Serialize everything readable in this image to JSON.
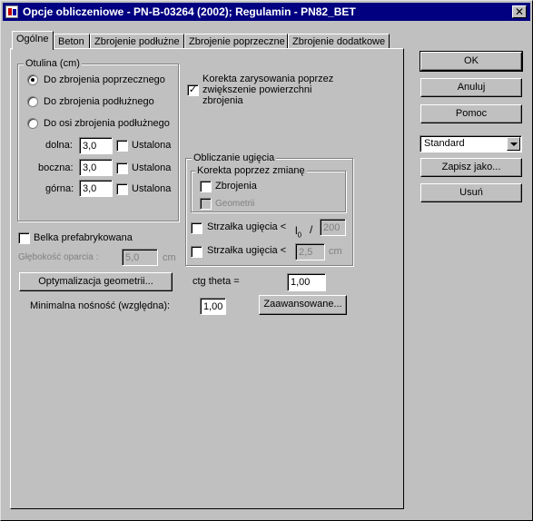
{
  "window": {
    "title": "Opcje obliczeniowe - PN-B-03264 (2002);   Regulamin - PN82_BET",
    "close_glyph": "✕"
  },
  "tabs": [
    {
      "label": "Ogólne"
    },
    {
      "label": "Beton"
    },
    {
      "label": "Zbrojenie podłużne"
    },
    {
      "label": "Zbrojenie poprzeczne"
    },
    {
      "label": "Zbrojenie dodatkowe"
    }
  ],
  "otulina": {
    "title": "Otulina (cm)",
    "radio_poprzeczne": "Do zbrojenia poprzecznego",
    "radio_podluzne": "Do zbrojenia podłużnego",
    "radio_osi": "Do osi zbrojenia podłużnego",
    "dolna_label": "dolna:",
    "dolna_value": "3,0",
    "boczna_label": "boczna:",
    "boczna_value": "3,0",
    "gorna_label": "górna:",
    "gorna_value": "3,0",
    "ustalona": "Ustalona"
  },
  "korekta": {
    "line1": "Korekta zarysowania poprzez",
    "line2": "zwiększenie powierzchni",
    "line3": "zbrojenia",
    "checked": "✓"
  },
  "ugiecie": {
    "title": "Obliczanie ugięcia",
    "sub_title": "Korekta poprzez zmianę",
    "zbrojenia": "Zbrojenia",
    "geometrii": "Geometrii",
    "strzalka_label": "Strzałka ugięcia <",
    "l0": "l",
    "l0_sub": "0",
    "slash": "/",
    "ratio_value": "200",
    "strzalka_cm_value": "2,5",
    "cm": "cm"
  },
  "belka": {
    "label": "Belka prefabrykowana",
    "glebokosc_label": "Głębokość oparcia :",
    "glebokosc_value": "5,0",
    "cm": "cm"
  },
  "buttons": {
    "optymalizacja": "Optymalizacja geometrii...",
    "zaawansowane": "Zaawansowane...",
    "ok": "OK",
    "anuluj": "Anuluj",
    "pomoc": "Pomoc",
    "zapisz": "Zapisz jako...",
    "usun": "Usuń"
  },
  "ctg": {
    "label": "ctg theta =",
    "value": "1,00"
  },
  "nosnosc": {
    "label": "Minimalna nośność (względna):",
    "value": "1,00"
  },
  "standard": {
    "value": "Standard"
  }
}
